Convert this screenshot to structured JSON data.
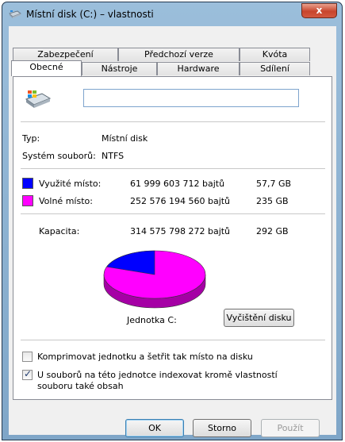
{
  "window": {
    "title": "Místní disk (C:) – vlastnosti",
    "close_label": "x"
  },
  "tabs_top": [
    {
      "label": "Zabezpečení"
    },
    {
      "label": "Předchozí verze"
    },
    {
      "label": "Kvóta"
    }
  ],
  "tabs_bottom": [
    {
      "label": "Obecné",
      "active": true
    },
    {
      "label": "Nástroje"
    },
    {
      "label": "Hardware"
    },
    {
      "label": "Sdílení"
    }
  ],
  "general": {
    "name_value": "",
    "type_label": "Typ:",
    "type_value": "Místní disk",
    "fs_label": "Systém souborů:",
    "fs_value": "NTFS",
    "used": {
      "label": "Využité místo:",
      "bytes": "61 999 603 712 bajtů",
      "size": "57,7 GB",
      "color": "#0000ff"
    },
    "free": {
      "label": "Volné místo:",
      "bytes": "252 576 194 560 bajtů",
      "size": "235 GB",
      "color": "#ff00ff"
    },
    "capacity": {
      "label": "Kapacita:",
      "bytes": "314 575 798 272 bajtů",
      "size": "292 GB"
    },
    "used_fraction": 0.197,
    "drive_label": "Jednotka C:",
    "cleanup_label": "Vyčištění disku"
  },
  "options": {
    "compress": {
      "label": "Komprimovat jednotku a šetřit tak místo na disku",
      "checked": false
    },
    "index": {
      "label_line1": "U souborů na této jednotce indexovat kromě vlastností",
      "label_line2": "souboru také obsah",
      "checked": true
    }
  },
  "buttons": {
    "ok": "OK",
    "cancel": "Storno",
    "apply": "Použít"
  }
}
